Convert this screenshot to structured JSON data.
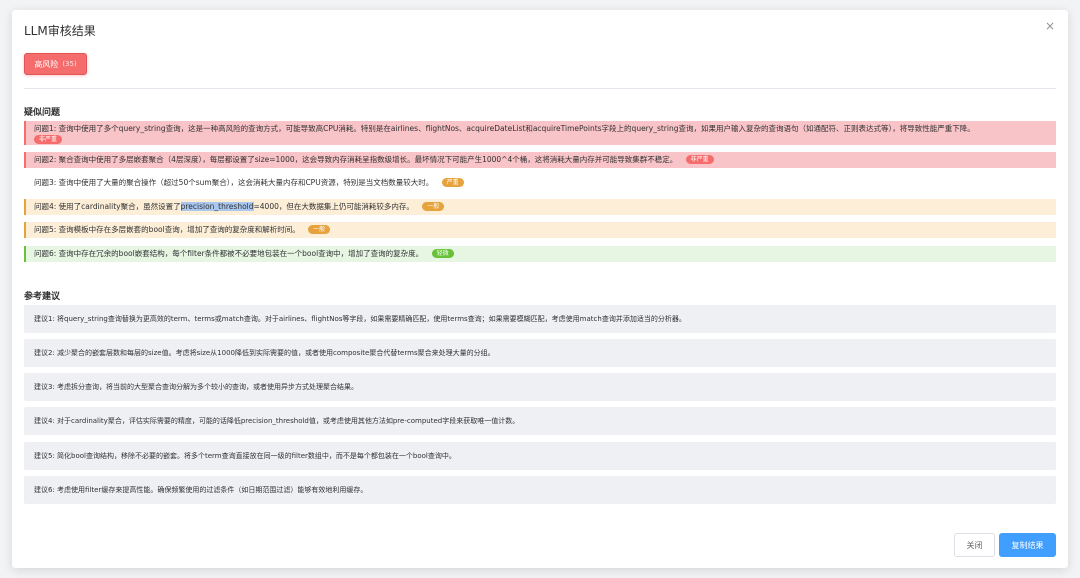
{
  "dialog": {
    "title": "LLM审核结果",
    "close_glyph": "×"
  },
  "risk": {
    "label": "高风险",
    "count": "(35)",
    "color": "#f56c6c"
  },
  "issues_section": {
    "title": "疑似问题",
    "items": [
      {
        "text": "问题1: 查询中使用了多个query_string查询，这是一种高风险的查询方式，可能导致高CPU消耗。特别是在airlines、flightNos、acquireDateList和acquireTimePoints字段上的query_string查询，如果用户输入复杂的查询语句（如通配符、正则表达式等），将导致性能严重下降。",
        "tag": "非严重",
        "severity": "severe"
      },
      {
        "text": "问题2: 聚合查询中使用了多层嵌套聚合（4层深度），每层都设置了size=1000，这会导致内存消耗呈指数级增长。最坏情况下可能产生1000^4个桶，这将消耗大量内存并可能导致集群不稳定。",
        "tag": "非严重",
        "severity": "severe"
      },
      {
        "text": "问题3: 查询中使用了大量的聚合操作（超过50个sum聚合），这会消耗大量内存和CPU资源，特别是当文档数量较大时。",
        "tag": "严重",
        "severity": "plain"
      },
      {
        "text_before": "问题4: 使用了cardinality聚合，虽然设置了",
        "text_selected": "precision_threshold",
        "text_after": "=4000，但在大数据集上仍可能消耗较多内存。",
        "tag": "一般",
        "severity": "normal"
      },
      {
        "text": "问题5: 查询模板中存在多层嵌套的bool查询，增加了查询的复杂度和解析时间。",
        "tag": "一般",
        "severity": "normal"
      },
      {
        "text": "问题6: 查询中存在冗余的bool嵌套结构，每个filter条件都被不必要地包装在一个bool查询中，增加了查询的复杂度。",
        "tag": "轻微",
        "severity": "light"
      }
    ]
  },
  "suggestions_section": {
    "title": "参考建议",
    "items": [
      "建议1: 将query_string查询替换为更高效的term、terms或match查询。对于airlines、flightNos等字段，如果需要精确匹配，使用terms查询；如果需要模糊匹配，考虑使用match查询并添加适当的分析器。",
      "建议2: 减少聚合的嵌套层数和每层的size值。考虑将size从1000降低到实际需要的值，或者使用composite聚合代替terms聚合来处理大量的分组。",
      "建议3: 考虑拆分查询，将当前的大型聚合查询分解为多个较小的查询，或者使用异步方式处理聚合结果。",
      "建议4: 对于cardinality聚合，评估实际需要的精度，可能的话降低precision_threshold值，或考虑使用其他方法如pre-computed字段来获取唯一值计数。",
      "建议5: 简化bool查询结构，移除不必要的嵌套。将多个term查询直接放在同一级的filter数组中，而不是每个都包装在一个bool查询中。",
      "建议6: 考虑使用filter缓存来提高性能。确保频繁使用的过滤条件（如日期范围过滤）能够有效地利用缓存。"
    ]
  },
  "footer": {
    "close_label": "关闭",
    "copy_label": "复制结果"
  },
  "colors": {
    "primary": "#409eff",
    "danger": "#f56c6c",
    "warning": "#e6a23c",
    "success": "#67c23a"
  }
}
